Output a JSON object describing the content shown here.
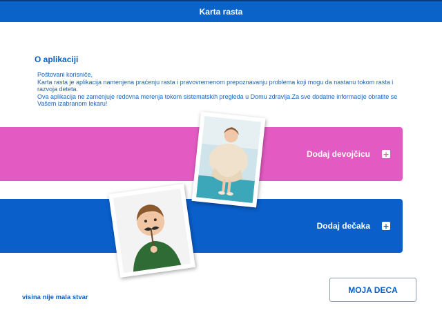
{
  "header": {
    "title": "Karta rasta"
  },
  "about": {
    "title": "O aplikaciji",
    "greeting": "Poštovani korisniče,",
    "paragraph1": "Karta rasta je aplikacija namenjena praćenju rasta i pravovremenom prepoznavanju problema koji mogu da nastanu tokom rasta i razvoja deteta.",
    "paragraph2": "Ova aplikacija ne zamenjuje redovna merenja tokom sistematskih pregleda u Domu zdravlja.Za sve dodatne informacije obratite se Vašem izabranom lekaru!"
  },
  "actions": {
    "add_girl": "Dodaj devojčicu",
    "add_boy": "Dodaj dečaka",
    "plus_symbol": "+"
  },
  "footer": {
    "slogan": "visina nije mala stvar",
    "my_kids_button": "MOJA DECA"
  },
  "colors": {
    "header_blue": "#0a63c9",
    "girl_pink": "#e35bc2",
    "boy_blue": "#0a5fcb",
    "text_blue": "#0a5fc2"
  }
}
